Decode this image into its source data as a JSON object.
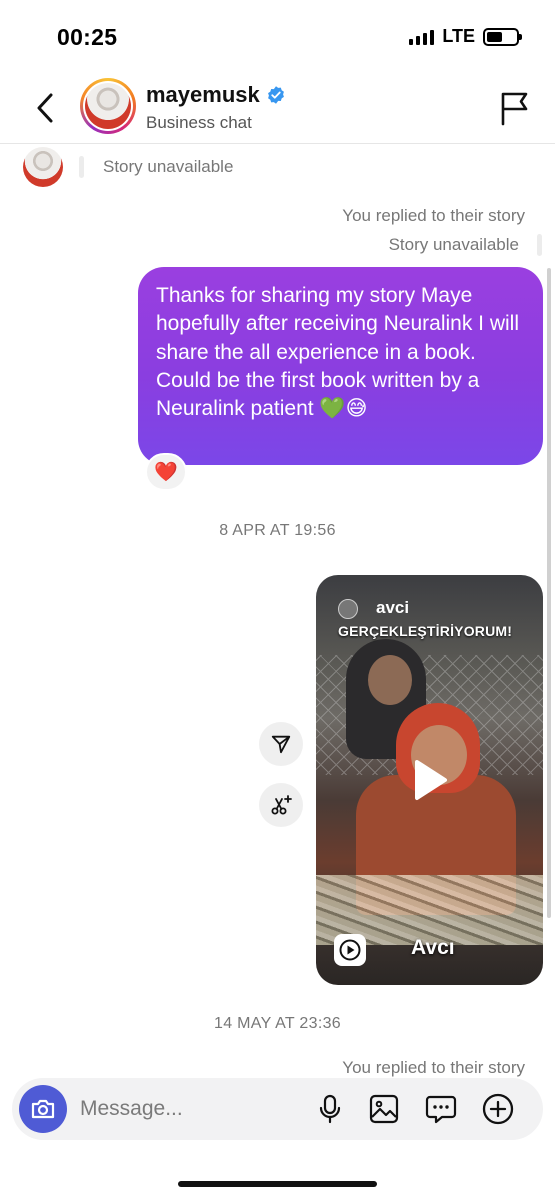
{
  "status_bar": {
    "time": "00:25",
    "network": "LTE",
    "battery_level_percent": 55,
    "signal_bars": 4
  },
  "header": {
    "username": "mayemusk",
    "subtitle": "Business chat",
    "verified": true,
    "back_icon": "chevron-left-icon",
    "flag_icon": "flag-icon",
    "accent_verified_color": "#3897f0"
  },
  "messages": {
    "story_unavailable_left": "Story unavailable",
    "replied_label_1": "You replied to their story",
    "story_unavailable_right": "Story unavailable",
    "outgoing_text": "Thanks for sharing my story Maye hopefully after receiving Neuralink I will share the all experience in a book. Could be the first book written by a Neuralink patient 💚😅",
    "reaction": "❤️",
    "timestamp_1": "8 APR AT 19:56",
    "reel": {
      "account_name": "avci",
      "caption": "GERÇEKLEŞTİRİYORUM!",
      "watermark": "Avcı",
      "play_icon": "play-icon",
      "reel_type_icon": "reels-icon"
    },
    "share_icon": "share-icon",
    "remix_icon": "remix-icon",
    "timestamp_2": "14 MAY AT 23:36",
    "replied_label_2": "You replied to their story"
  },
  "composer": {
    "placeholder": "Message...",
    "camera_icon": "camera-icon",
    "mic_icon": "microphone-icon",
    "gallery_icon": "gallery-icon",
    "sticker_icon": "chat-sticker-icon",
    "plus_icon": "plus-icon",
    "camera_color": "#4f5bd5"
  },
  "colors": {
    "bubble_gradient_top": "#9a3fe0",
    "bubble_gradient_bottom": "#7b47e8"
  }
}
